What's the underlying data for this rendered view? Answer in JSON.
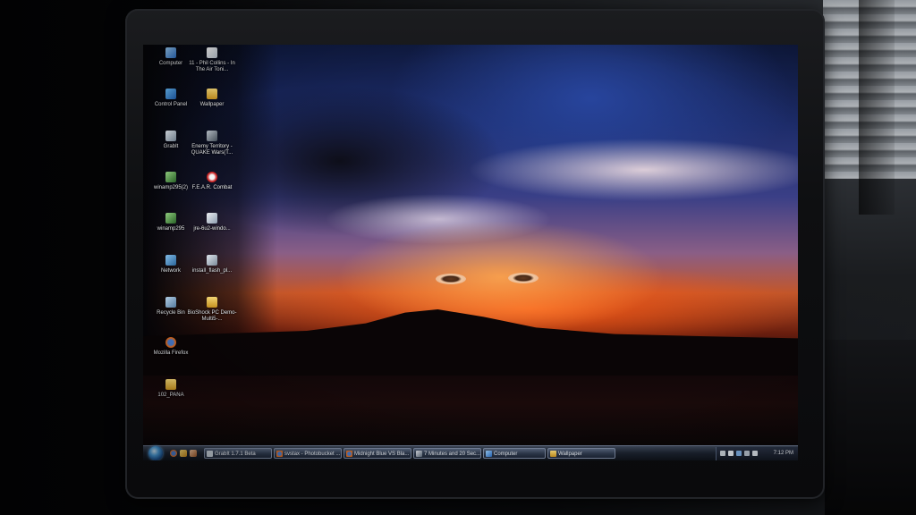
{
  "desktop": {
    "icons": [
      {
        "label": "Computer",
        "icon": "computer-icon"
      },
      {
        "label": "11 - Phil Collins - In The Air Toni...",
        "icon": "document-icon"
      },
      {
        "label": "Control Panel",
        "icon": "control-panel-icon"
      },
      {
        "label": "Wallpaper",
        "icon": "folder-icon"
      },
      {
        "label": "GrabIt",
        "icon": "grabit-icon"
      },
      {
        "label": "Enemy Territory - QUAKE Wars(T...",
        "icon": "game-icon"
      },
      {
        "label": "winamp295(2)",
        "icon": "winamp-icon"
      },
      {
        "label": "F.E.A.R. Combat",
        "icon": "fear-icon"
      },
      {
        "label": "winamp295",
        "icon": "winamp-icon"
      },
      {
        "label": "jre-6u2-windo...",
        "icon": "java-installer-icon"
      },
      {
        "label": "Network",
        "icon": "network-icon"
      },
      {
        "label": "install_flash_pl...",
        "icon": "installer-icon"
      },
      {
        "label": "Recycle Bin",
        "icon": "recycle-bin-icon"
      },
      {
        "label": "BioShock PC Demo-Multi5-...",
        "icon": "folder-icon"
      },
      {
        "label": "Mozilla Firefox",
        "icon": "firefox-icon"
      },
      {
        "label": "102_PANA",
        "icon": "folder-icon"
      }
    ]
  },
  "taskbar": {
    "start_icon": "windows-start-orb",
    "quick_launch": [
      "firefox-icon",
      "folder-icon",
      "media-icon"
    ],
    "tasks": [
      {
        "label": "GrabIt 1.7.1 Beta",
        "icon": "grabit-icon"
      },
      {
        "label": "svstax - Photobucket ...",
        "icon": "firefox-icon"
      },
      {
        "label": "Midnight Blue VS Bla...",
        "icon": "firefox-icon"
      },
      {
        "label": "7 Minutes and 20 Sec...",
        "icon": "media-icon"
      },
      {
        "label": "Computer",
        "icon": "computer-icon"
      },
      {
        "label": "Wallpaper",
        "icon": "folder-icon"
      }
    ],
    "clock": "7:12 PM"
  }
}
